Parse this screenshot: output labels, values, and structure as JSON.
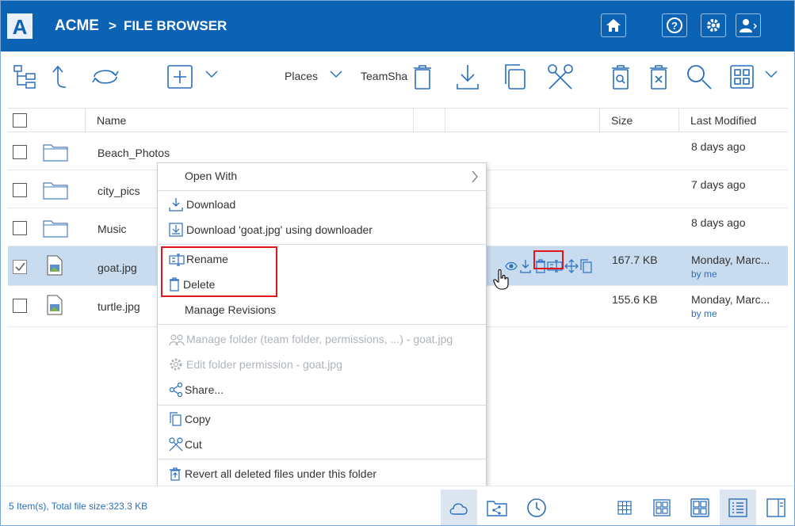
{
  "header": {
    "logo_letter": "A",
    "brand": "ACME",
    "separator": ">",
    "breadcrumb": "FILE BROWSER"
  },
  "toolbar": {
    "places_label": "Places",
    "teamshare_label": "TeamSha"
  },
  "table": {
    "columns": [
      "Name",
      "Size",
      "Last Modified"
    ],
    "rows": [
      {
        "name": "Beach_Photos",
        "type": "folder",
        "size": "",
        "modified": "8 days ago",
        "by": "",
        "selected": false
      },
      {
        "name": "city_pics",
        "type": "folder",
        "size": "",
        "modified": "7 days ago",
        "by": "",
        "selected": false
      },
      {
        "name": "Music",
        "type": "folder",
        "size": "",
        "modified": "8 days ago",
        "by": "",
        "selected": false
      },
      {
        "name": "goat.jpg",
        "type": "image",
        "size": "167.7 KB",
        "modified": "Monday, Marc...",
        "by": "by me",
        "selected": true
      },
      {
        "name": "turtle.jpg",
        "type": "image",
        "size": "155.6 KB",
        "modified": "Monday, Marc...",
        "by": "by me",
        "selected": false
      }
    ]
  },
  "context_menu": {
    "open_with": "Open With",
    "download": "Download",
    "download_using": "Download 'goat.jpg' using downloader",
    "rename": "Rename",
    "delete": "Delete",
    "manage_revisions": "Manage Revisions",
    "manage_folder": "Manage folder (team folder, permissions, ...) - goat.jpg",
    "edit_permission": "Edit folder permission - goat.jpg",
    "share": "Share...",
    "copy": "Copy",
    "cut": "Cut",
    "revert": "Revert all deleted files under this folder"
  },
  "status": {
    "summary": "5 Item(s), Total file size:323.3 KB"
  },
  "colors": {
    "header_bg": "#0c63b3",
    "accent": "#2a6fbd",
    "selected_row": "#c9dcef",
    "highlight": "#e0161b"
  }
}
